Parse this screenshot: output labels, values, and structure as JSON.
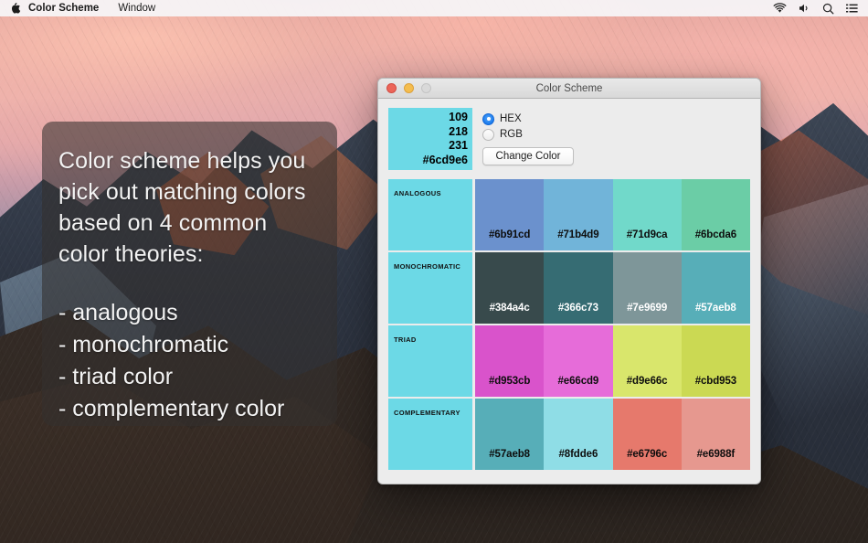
{
  "menubar": {
    "apple_icon": "apple-logo-icon",
    "app_name": "Color Scheme",
    "menus": [
      "Window"
    ],
    "status_icons": [
      "wifi-icon",
      "volume-icon",
      "search-icon",
      "notification-center-icon"
    ]
  },
  "info_panel": {
    "paragraph": "Color scheme helps you pick out matching colors based on 4 common color theories:",
    "bullets": [
      "- analogous",
      "- monochromatic",
      "- triad color",
      "- complementary color"
    ]
  },
  "window": {
    "title": "Color Scheme",
    "traffic_lights": [
      "close-button",
      "minimize-button",
      "zoom-button"
    ],
    "base_color": {
      "r": "109",
      "g": "218",
      "b": "231",
      "hex": "#6cd9e6"
    },
    "format_options": [
      {
        "label": "HEX",
        "selected": true
      },
      {
        "label": "RGB",
        "selected": false
      }
    ],
    "change_color_label": "Change Color",
    "schemes": [
      {
        "label": "ANALOGOUS",
        "swatch": "#6cd9e6",
        "colors": [
          {
            "hex": "#6b91cd",
            "light_text": false
          },
          {
            "hex": "#71b4d9",
            "light_text": false
          },
          {
            "hex": "#71d9ca",
            "light_text": false
          },
          {
            "hex": "#6bcda6",
            "light_text": false
          }
        ]
      },
      {
        "label": "MONOCHROMATIC",
        "swatch": "#6cd9e6",
        "colors": [
          {
            "hex": "#384a4c",
            "light_text": true
          },
          {
            "hex": "#366c73",
            "light_text": true
          },
          {
            "hex": "#7e9699",
            "light_text": true
          },
          {
            "hex": "#57aeb8",
            "light_text": true
          }
        ]
      },
      {
        "label": "TRIAD",
        "swatch": "#6cd9e6",
        "colors": [
          {
            "hex": "#d953cb",
            "light_text": false
          },
          {
            "hex": "#e66cd9",
            "light_text": false
          },
          {
            "hex": "#d9e66c",
            "light_text": false
          },
          {
            "hex": "#cbd953",
            "light_text": false
          }
        ]
      },
      {
        "label": "COMPLEMENTARY",
        "swatch": "#6cd9e6",
        "colors": [
          {
            "hex": "#57aeb8",
            "light_text": false
          },
          {
            "hex": "#8fdde6",
            "light_text": false
          },
          {
            "hex": "#e6796c",
            "light_text": false
          },
          {
            "hex": "#e6988f",
            "light_text": false
          }
        ]
      }
    ]
  }
}
